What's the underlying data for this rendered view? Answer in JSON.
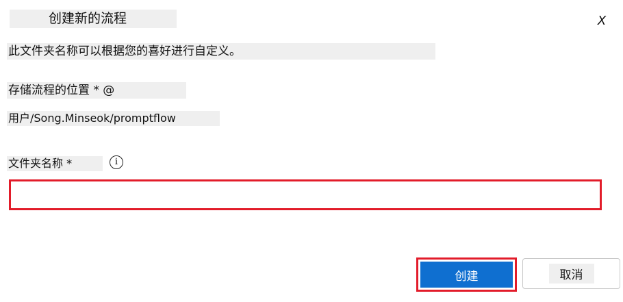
{
  "dialog": {
    "title": "创建新的流程",
    "close_label": "X",
    "description": "此文件夹名称可以根据您的喜好进行自定义。",
    "location": {
      "label": "存储流程的位置 * @",
      "value": "用户/Song.Minseok/promptflow"
    },
    "folder_name": {
      "label": "文件夹名称 *",
      "info_glyph": "i",
      "value": "",
      "placeholder": ""
    },
    "buttons": {
      "create": "创建",
      "cancel": "取消"
    },
    "colors": {
      "primary": "#0f6fd0",
      "highlight": "#e21c2a"
    }
  }
}
